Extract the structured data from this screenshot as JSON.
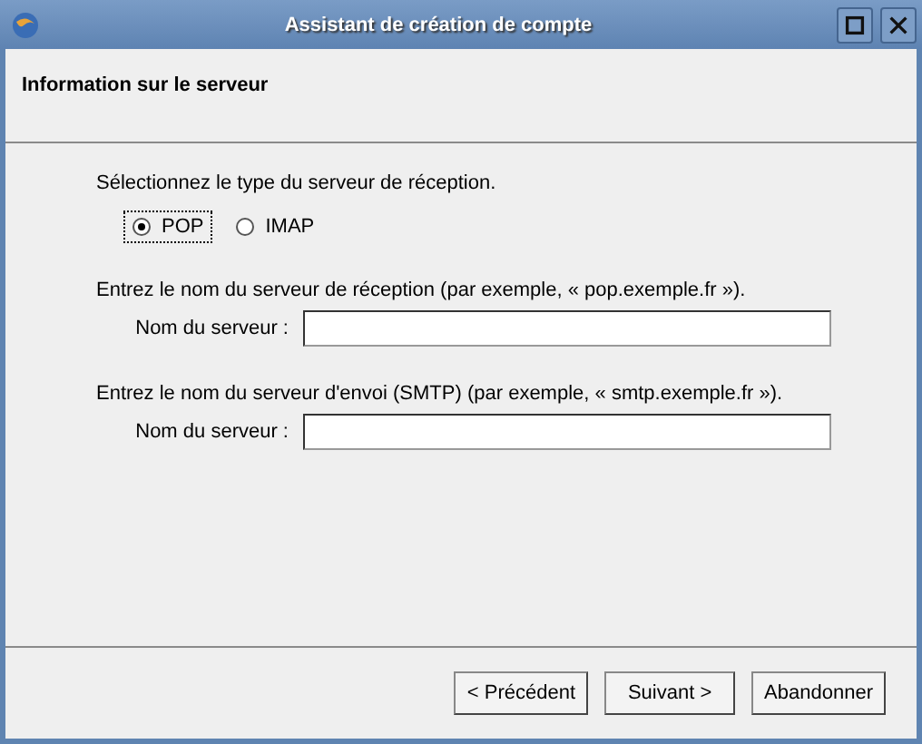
{
  "window": {
    "title": "Assistant de création de compte"
  },
  "header": {
    "title": "Information sur le serveur"
  },
  "incoming_type": {
    "prompt": "Sélectionnez le type du serveur de réception.",
    "options": [
      {
        "label": "POP",
        "selected": true
      },
      {
        "label": "IMAP",
        "selected": false
      }
    ]
  },
  "servers": [
    {
      "prompt": "Entrez le nom du serveur de réception (par exemple, « pop.exemple.fr »).",
      "label": "Nom du serveur :"
    },
    {
      "prompt": "Entrez le nom du serveur d'envoi (SMTP) (par exemple, « smtp.exemple.fr »).",
      "label": "Nom du serveur :"
    }
  ],
  "buttons": [
    "< Précédent",
    "Suivant >",
    "Abandonner"
  ]
}
